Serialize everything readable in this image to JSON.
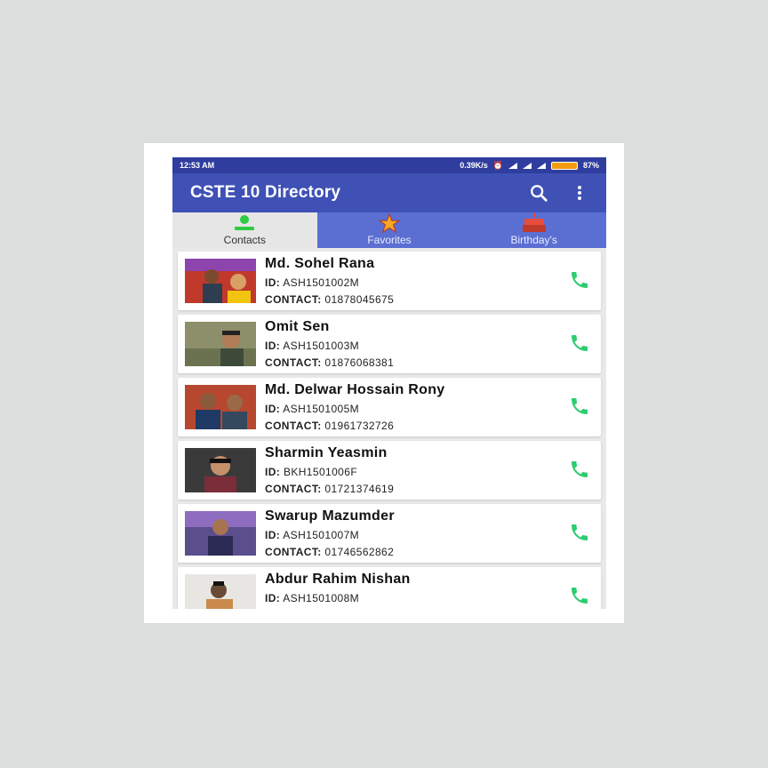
{
  "status": {
    "time": "12:53 AM",
    "speed": "0.39K/s",
    "battery": "87%"
  },
  "appbar": {
    "title": "CSTE 10 Directory",
    "search_icon": "search-icon",
    "menu_icon": "more-vert-icon"
  },
  "tabs": [
    {
      "label": "Contacts",
      "icon": "person-icon",
      "active": true
    },
    {
      "label": "Favorites",
      "icon": "star-icon",
      "active": false
    },
    {
      "label": "Birthday's",
      "icon": "cake-icon",
      "active": false
    }
  ],
  "labels": {
    "id": "ID:",
    "contact": "CONTACT:"
  },
  "contacts": [
    {
      "name": "Md. Sohel Rana",
      "id": "ASH1501002M",
      "contact": "01878045675"
    },
    {
      "name": "Omit Sen",
      "id": "ASH1501003M",
      "contact": "01876068381"
    },
    {
      "name": "Md. Delwar Hossain Rony",
      "id": "ASH1501005M",
      "contact": "01961732726"
    },
    {
      "name": "Sharmin Yeasmin",
      "id": "BKH1501006F",
      "contact": "01721374619"
    },
    {
      "name": "Swarup Mazumder",
      "id": "ASH1501007M",
      "contact": "01746562862"
    },
    {
      "name": "Abdur Rahim Nishan",
      "id": "ASH1501008M",
      "contact": ""
    }
  ],
  "colors": {
    "primary": "#3f51b5",
    "status_bar": "#2f3e9e",
    "call_green": "#2ecc71",
    "tab_active_icon": "#2ecc40"
  }
}
